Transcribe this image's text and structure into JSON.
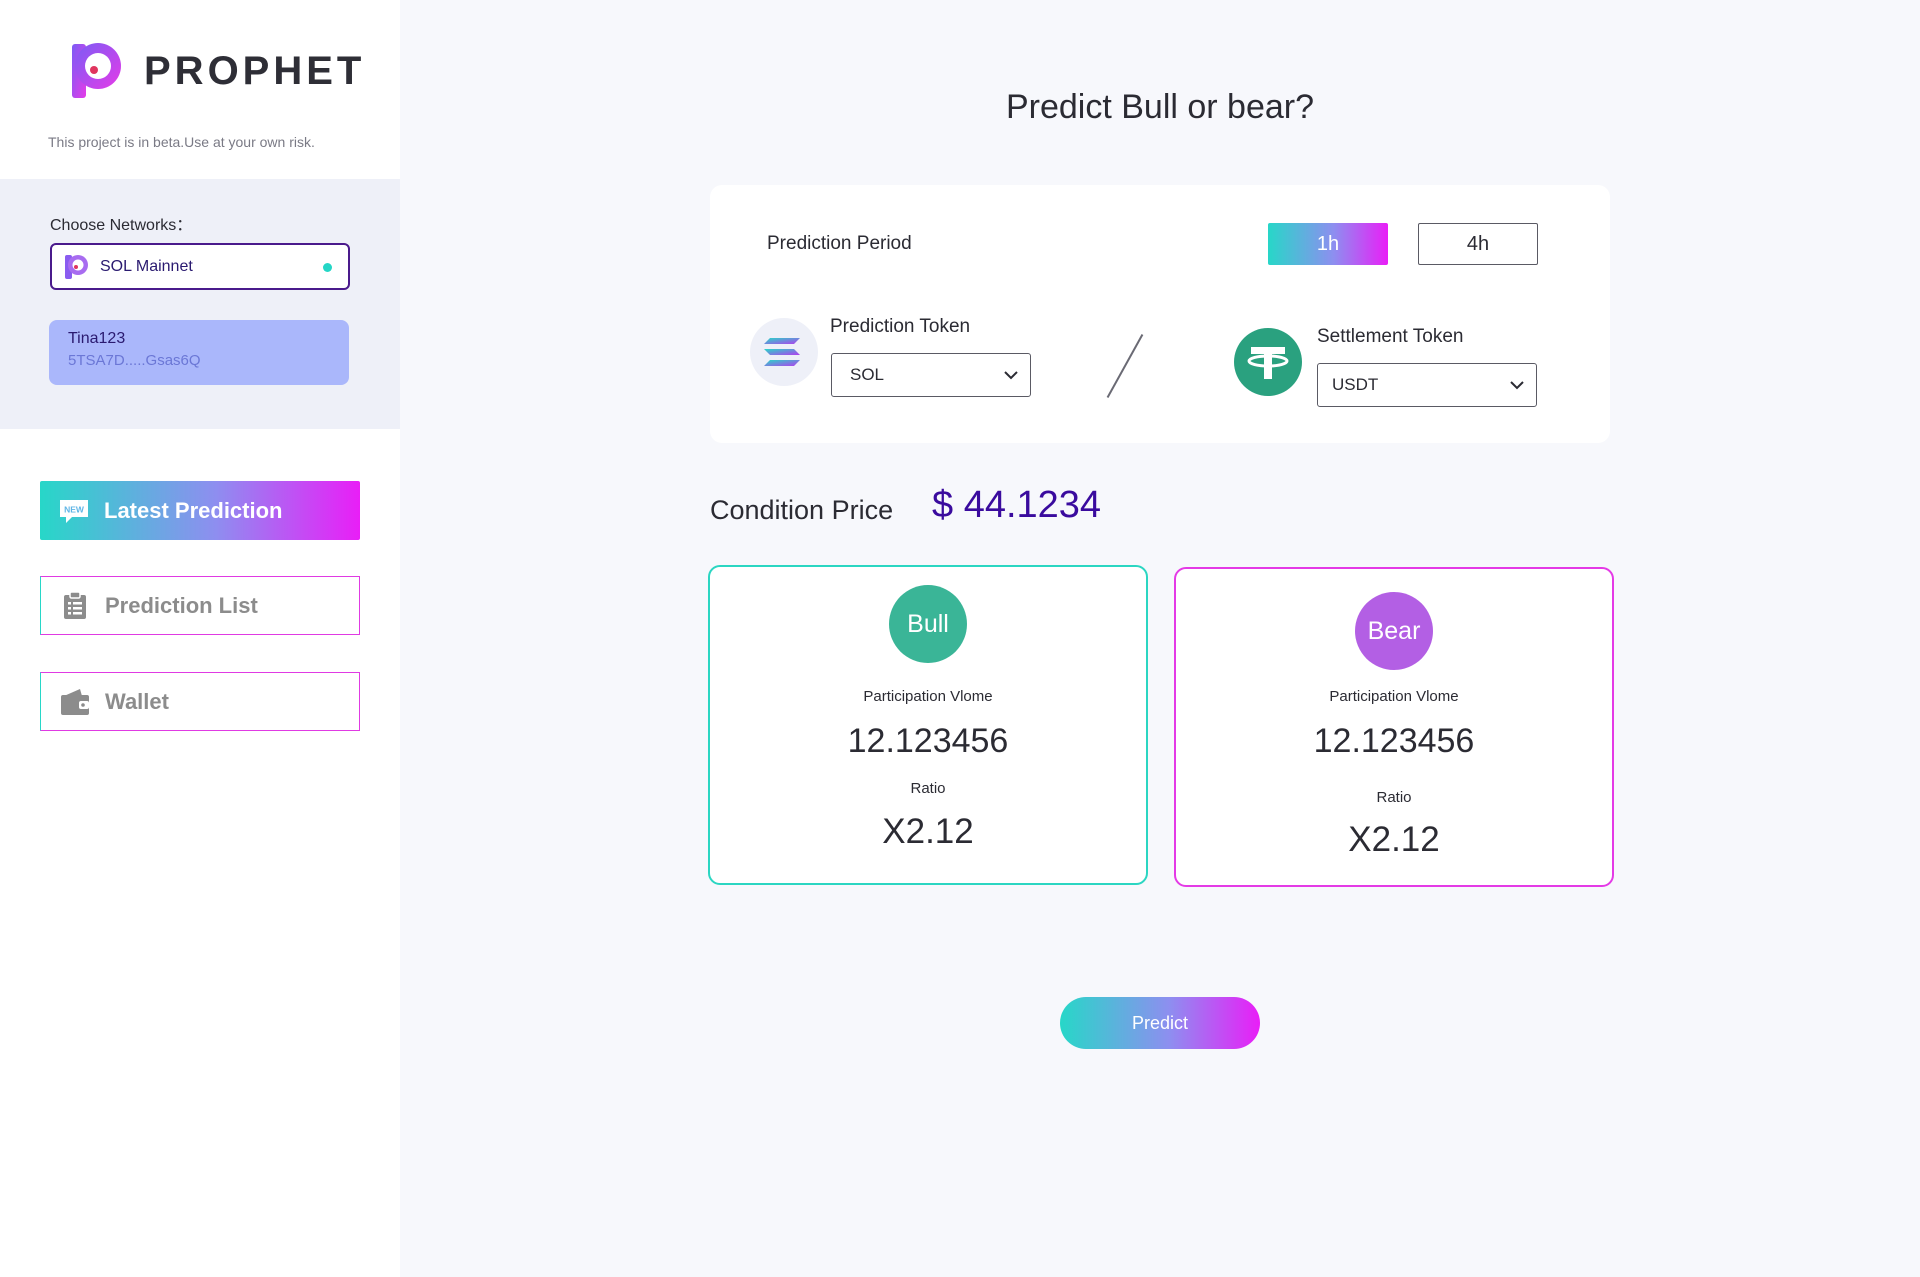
{
  "app": {
    "name": "PROPHET",
    "beta_note": "This project is in beta.Use at your own risk."
  },
  "sidebar": {
    "networks_label": "Choose Networks：",
    "selected_network": "SOL Mainnet",
    "account": {
      "name": "Tina123",
      "address": "5TSA7D.....Gsas6Q"
    },
    "nav": {
      "latest": "Latest Prediction",
      "list": "Prediction List",
      "wallet": "Wallet"
    },
    "new_badge": "NEW"
  },
  "main": {
    "title": "Predict Bull or bear?",
    "period_label": "Prediction Period",
    "periods": [
      "1h",
      "4h"
    ],
    "selected_period": "1h",
    "prediction_token_label": "Prediction Token",
    "prediction_token_value": "SOL",
    "settlement_token_label": "Settlement Token",
    "settlement_token_value": "USDT",
    "condition_label": "Condition Price",
    "condition_value": "$ 44.1234",
    "bull": {
      "badge": "Bull",
      "volume_label": "Participation Vlome",
      "volume": "12.123456",
      "ratio_label": "Ratio",
      "ratio": "X2.12"
    },
    "bear": {
      "badge": "Bear",
      "volume_label": "Participation Vlome",
      "volume": "12.123456",
      "ratio_label": "Ratio",
      "ratio": "X2.12"
    },
    "predict_button": "Predict"
  },
  "colors": {
    "accent_teal": "#27d7c8",
    "accent_pink": "#e91ef7",
    "price_purple": "#3a0b9e",
    "bull_green": "#3ab597",
    "bear_purple": "#b35fe4"
  }
}
